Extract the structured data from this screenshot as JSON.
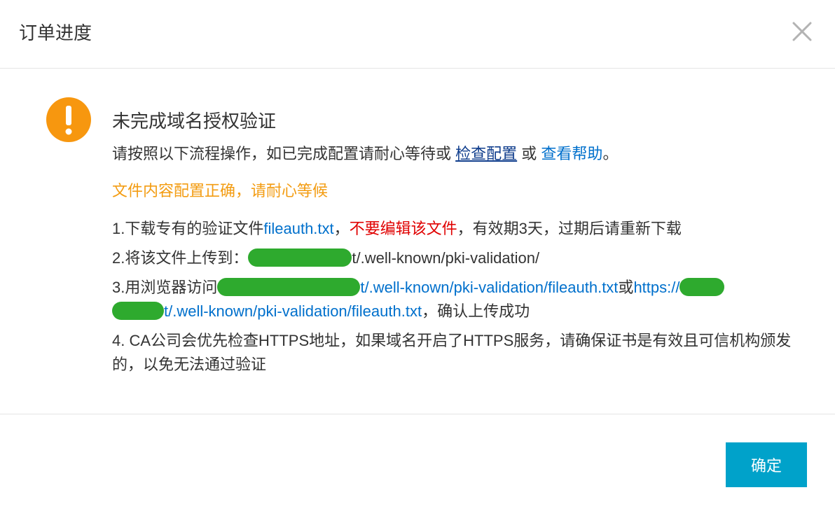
{
  "header": {
    "title": "订单进度"
  },
  "status": {
    "title": "未完成域名授权验证",
    "instruction_prefix": "请按照以下流程操作，如已完成配置请耐心等待或",
    "check_link": "检查配置",
    "or_word": "或",
    "help_link": "查看帮助",
    "instruction_suffix": "。",
    "file_status": "文件内容配置正确，请耐心等候"
  },
  "steps": {
    "s1_prefix": "1.下载专有的验证文件",
    "s1_file": "fileauth.txt",
    "s1_comma": "，",
    "s1_warning": "不要编辑该文件",
    "s1_suffix": "，有效期3天，过期后请重新下载",
    "s2_prefix": "2.将该文件上传到：",
    "s2_path": "t/.well-known/pki-validation/",
    "s3_prefix": "3.用浏览器访问",
    "s3_url1_tail": "t/.well-known/pki-validation/fileauth.txt",
    "s3_or": "或",
    "s3_https": "https://",
    "s3_url2_tail": "t/.well-known/pki-validation/fileauth.txt",
    "s3_suffix": "，确认上传成功",
    "s4_text": "4. CA公司会优先检查HTTPS地址，如果域名开启了HTTPS服务，请确保证书是有效且可信机构颁发的，以免无法通过验证"
  },
  "footer": {
    "ok_label": "确定"
  },
  "colors": {
    "accent": "#00a2ca",
    "warning_orange": "#f39c12",
    "warning_red": "#e00000",
    "link_blue": "#0070cc",
    "redaction_green": "#2eaa2e"
  },
  "icons": {
    "close": "close-icon",
    "warning": "warning-icon"
  }
}
